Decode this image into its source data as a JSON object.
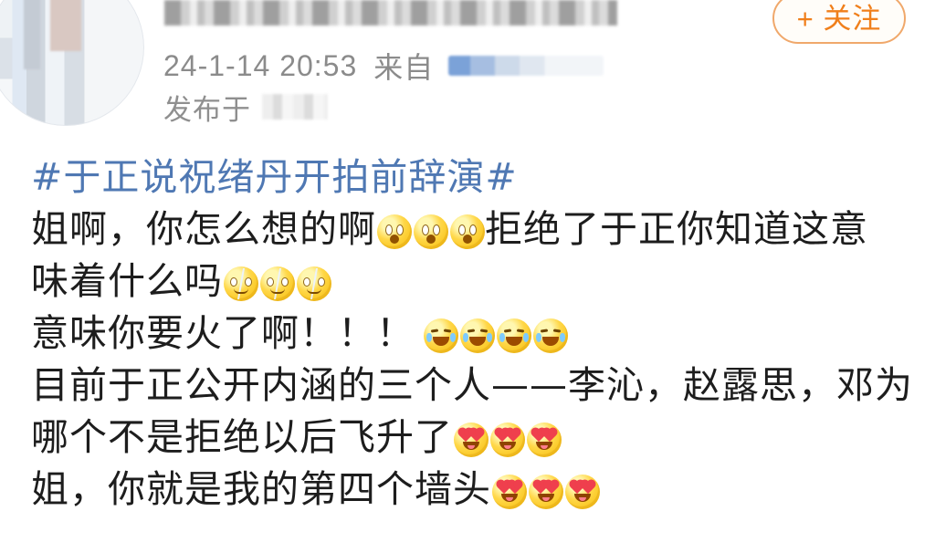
{
  "header": {
    "timestamp": "24-1-14 20:53",
    "source_label": "来自",
    "publish_label": "发布于",
    "follow_button": "+ 关注"
  },
  "post": {
    "lines": [
      {
        "text": "#于正说祝绪丹开拍前辞演#"
      },
      {
        "before": "姐啊，你怎么想的啊",
        "after": "拒绝了于正你知道这意"
      },
      {
        "text": "味着什么吗"
      },
      {
        "text": "意味你要火了啊！！！"
      },
      {
        "text": "目前于正公开内涵的三个人——李沁，赵露思，邓为"
      },
      {
        "text": "哪个不是拒绝以后飞升了"
      },
      {
        "text": "姐，你就是我的第四个墙头"
      }
    ]
  },
  "emoji_sets": {
    "line_2": [
      "hushed-face-icon",
      "hushed-face-icon",
      "hushed-face-icon"
    ],
    "line_3": [
      "cracked-face-icon",
      "cracked-face-icon",
      "cracked-face-icon"
    ],
    "line_4": [
      "crying-face-icon",
      "crying-face-icon",
      "crying-face-icon",
      "crying-face-icon"
    ],
    "line_6": [
      "heart-eyes-face-icon",
      "heart-eyes-face-icon",
      "heart-eyes-face-icon"
    ],
    "line_7": [
      "heart-eyes-face-icon",
      "heart-eyes-face-icon",
      "heart-eyes-face-icon"
    ]
  },
  "colors": {
    "topic_blue": "#4f78b3",
    "meta_gray": "#8b8b8b",
    "follow_orange": "#f07f1b",
    "body_text": "#1d1d1d",
    "emoji_yellow": "#ffd748"
  }
}
